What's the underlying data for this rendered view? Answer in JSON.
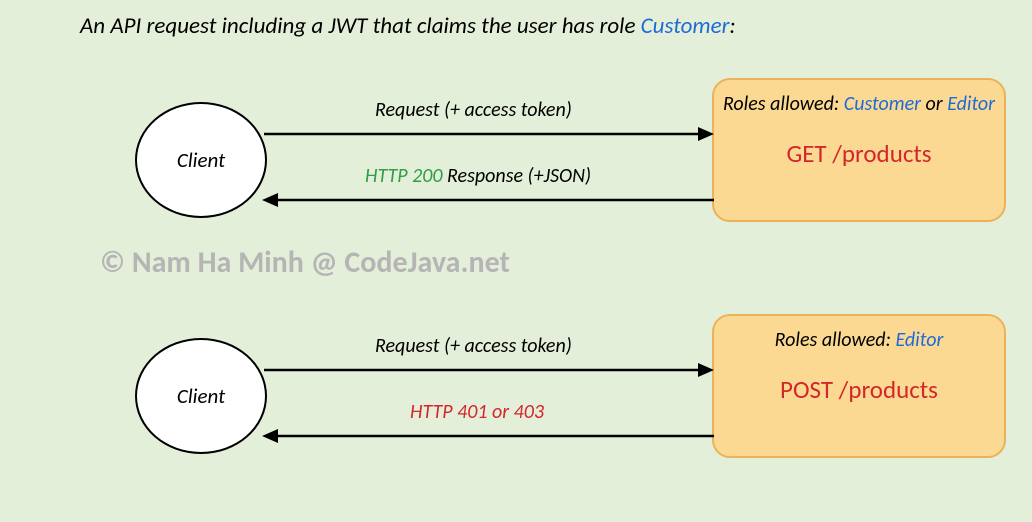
{
  "title_prefix": "An API request including a JWT that claims the user has role ",
  "title_role": "Customer",
  "title_suffix": ":",
  "client_label": "Client",
  "flow1": {
    "request_label": "Request (+ access token)",
    "response_status": "HTTP 200",
    "response_suffix": " Response (+JSON)",
    "roles_prefix": "Roles allowed:",
    "role1": "Customer",
    "role_join": " or ",
    "role2": "Editor",
    "endpoint": "GET /products"
  },
  "flow2": {
    "request_label": "Request (+ access token)",
    "error_label": "HTTP 401 or 403",
    "roles_prefix": "Roles allowed:  ",
    "role1": "Editor",
    "endpoint": "POST /products"
  },
  "watermark": "© Nam Ha Minh @ CodeJava.net"
}
